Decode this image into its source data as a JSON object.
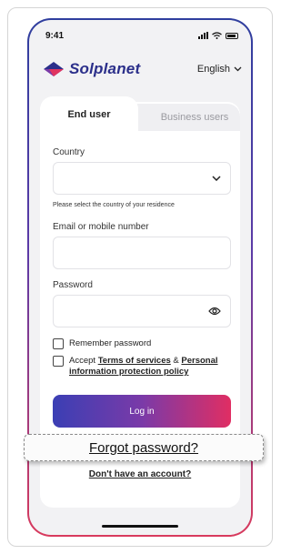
{
  "status_bar": {
    "time": "9:41"
  },
  "brand": {
    "name": "Solplanet",
    "logo_colors": [
      "#2b2f8a",
      "#5a3aa8",
      "#e0345f"
    ]
  },
  "language": {
    "label": "English",
    "icon": "chevron-down-icon"
  },
  "tabs": [
    {
      "label": "End user",
      "active": true
    },
    {
      "label": "Business users",
      "active": false
    }
  ],
  "form": {
    "country_label": "Country",
    "country_value": "",
    "country_hint": "Please select the country of your residence",
    "email_label": "Email or mobile number",
    "email_value": "",
    "password_label": "Password",
    "password_value": "",
    "remember_label": "Remember password",
    "remember_checked": false,
    "accept_prefix": "Accept ",
    "terms_link": "Terms of services",
    "accept_and": " & ",
    "privacy_link": "Personal information protection policy",
    "accept_checked": false,
    "login_label": "Log in",
    "no_account_label": "Don't have an account?"
  },
  "forgot_password": "Forgot password?",
  "colors": {
    "accent_start": "#3b3fb4",
    "accent_end": "#e02e63",
    "frame_top": "#2f3e9e",
    "frame_bottom": "#d83a5d"
  }
}
